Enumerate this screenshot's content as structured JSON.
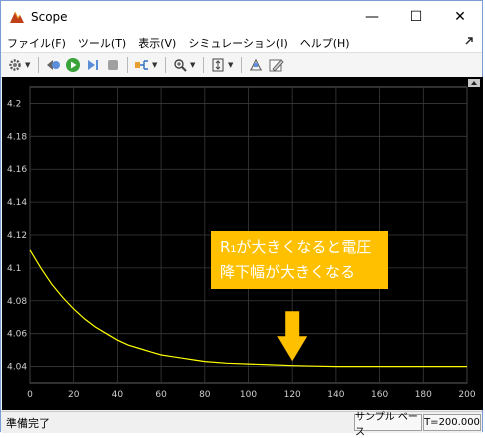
{
  "window": {
    "title": "Scope",
    "controls": [
      "—",
      "☐",
      "✕"
    ]
  },
  "menu": {
    "items": [
      "ファイル(F)",
      "ツール(T)",
      "表示(V)",
      "シミュレーション(I)",
      "ヘルプ(H)"
    ]
  },
  "toolbar": {
    "buttons": [
      "gear-icon",
      "step-back-icon",
      "run-icon",
      "step-forward-icon",
      "stop-icon",
      "highlight-icon",
      "zoom-icon",
      "fit-icon",
      "cursor-icon",
      "edit-icon"
    ]
  },
  "annotation": {
    "line1": "R₁が大きくなると電圧",
    "line2": "降下幅が大きくなる"
  },
  "status": {
    "left": "準備完了",
    "mode": "サンプル ベース",
    "time": "T=200.000"
  },
  "colors": {
    "plot_bg": "#000000",
    "grid": "#3a3a3a",
    "trace": "#ffff00",
    "tick_text": "#cfcfcf",
    "annotation_bg": "#ffc000",
    "arrow": "#ffc000"
  },
  "chart_data": {
    "type": "line",
    "title": "",
    "xlabel": "",
    "ylabel": "",
    "xlim": [
      0,
      200
    ],
    "ylim": [
      4.03,
      4.21
    ],
    "xticks": [
      0,
      20,
      40,
      60,
      80,
      100,
      120,
      140,
      160,
      180,
      200
    ],
    "yticks": [
      4.04,
      4.06,
      4.08,
      4.1,
      4.12,
      4.14,
      4.16,
      4.18,
      4.2
    ],
    "ytick_labels": [
      "4.04",
      "4.06",
      "4.08",
      "4.1",
      "4.12",
      "4.14",
      "4.16",
      "4.18",
      "4.2"
    ],
    "grid": true,
    "series": [
      {
        "x": [
          0,
          5,
          10,
          15,
          20,
          25,
          30,
          35,
          40,
          45,
          50,
          55,
          60,
          65,
          70,
          75,
          80,
          90,
          100,
          110,
          120,
          130,
          140,
          150,
          160,
          180,
          200
        ],
        "values": [
          4.111,
          4.1,
          4.09,
          4.082,
          4.075,
          4.069,
          4.064,
          4.06,
          4.056,
          4.053,
          4.051,
          4.049,
          4.047,
          4.046,
          4.045,
          4.044,
          4.043,
          4.042,
          4.0415,
          4.041,
          4.0405,
          4.0402,
          4.04,
          4.04,
          4.04,
          4.04,
          4.04
        ]
      }
    ]
  }
}
